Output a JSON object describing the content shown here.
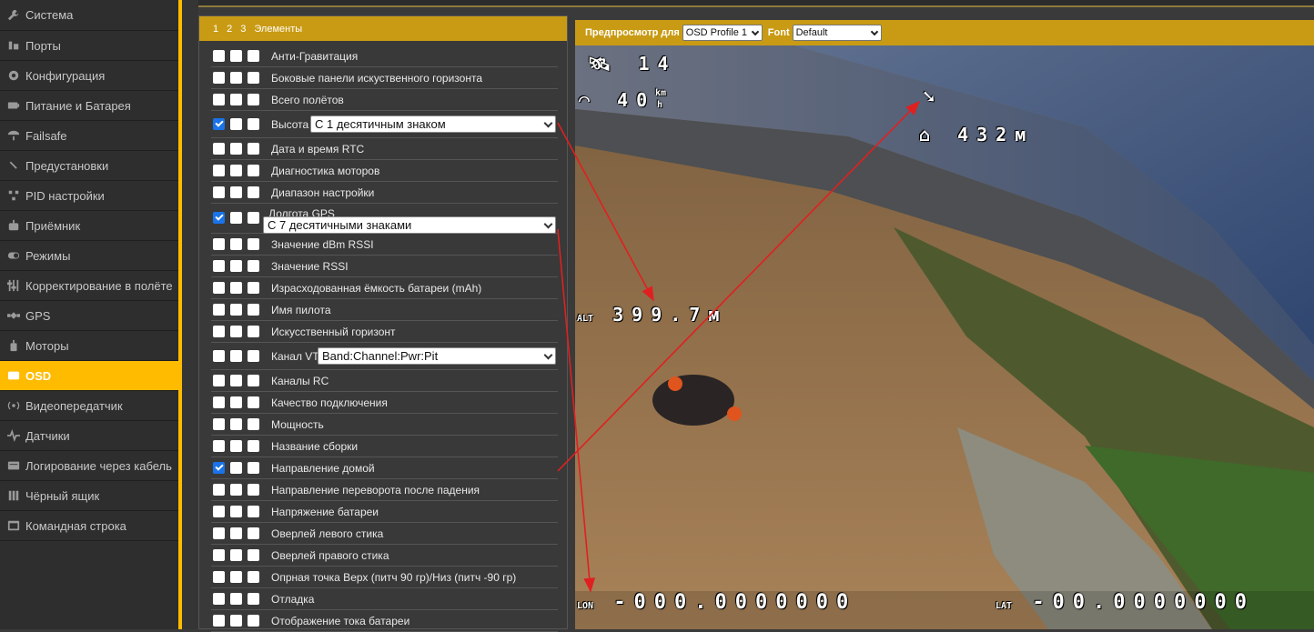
{
  "sidebar": {
    "items": [
      {
        "label": "Система",
        "icon": "wrench-icon",
        "active": false
      },
      {
        "label": "Порты",
        "icon": "plug-icon",
        "active": false
      },
      {
        "label": "Конфигурация",
        "icon": "gear-icon",
        "active": false
      },
      {
        "label": "Питание и Батарея",
        "icon": "battery-icon",
        "active": false
      },
      {
        "label": "Failsafe",
        "icon": "parachute-icon",
        "active": false
      },
      {
        "label": "Предустановки",
        "icon": "magic-wand-icon",
        "active": false
      },
      {
        "label": "PID настройки",
        "icon": "pid-icon",
        "active": false
      },
      {
        "label": "Приёмник",
        "icon": "receiver-icon",
        "active": false
      },
      {
        "label": "Режимы",
        "icon": "toggle-icon",
        "active": false
      },
      {
        "label": "Корректирование в полёте",
        "icon": "sliders-icon",
        "active": false
      },
      {
        "label": "GPS",
        "icon": "satellite-icon",
        "active": false
      },
      {
        "label": "Моторы",
        "icon": "motor-icon",
        "active": false
      },
      {
        "label": "OSD",
        "icon": "osd-icon",
        "active": true
      },
      {
        "label": "Видеопередатчик",
        "icon": "broadcast-icon",
        "active": false
      },
      {
        "label": "Датчики",
        "icon": "pulse-icon",
        "active": false
      },
      {
        "label": "Логирование через кабель",
        "icon": "cable-icon",
        "active": false
      },
      {
        "label": "Чёрный ящик",
        "icon": "blackbox-icon",
        "active": false
      },
      {
        "label": "Командная строка",
        "icon": "terminal-icon",
        "active": false
      }
    ]
  },
  "elements_panel": {
    "header": {
      "profile_1": "1",
      "profile_2": "2",
      "profile_3": "3",
      "title": "Элементы"
    },
    "rows": [
      {
        "label": "Анти-Гравитация",
        "checked": false
      },
      {
        "label": "Боковые панели искуственного горизонта",
        "checked": false
      },
      {
        "label": "Всего полётов",
        "checked": false
      },
      {
        "label": "Высота",
        "checked": true,
        "select": "С 1 десятичным знаком"
      },
      {
        "label": "Дата и время RTC",
        "checked": false
      },
      {
        "label": "Диагностика моторов",
        "checked": false
      },
      {
        "label": "Диапазон настройки",
        "checked": false
      },
      {
        "label": "Долгота GPS",
        "checked": true,
        "select": "С 7 десятичными знаками"
      },
      {
        "label": "Значение dBm RSSI",
        "checked": false
      },
      {
        "label": "Значение RSSI",
        "checked": false
      },
      {
        "label": "Израсходованная ёмкость батареи (mAh)",
        "checked": false
      },
      {
        "label": "Имя пилота",
        "checked": false
      },
      {
        "label": "Искусственный горизонт",
        "checked": false
      },
      {
        "label": "Канал VTX",
        "checked": false,
        "select": "Band:Channel:Pwr:Pit"
      },
      {
        "label": "Каналы RC",
        "checked": false
      },
      {
        "label": "Качество подключения",
        "checked": false
      },
      {
        "label": "Мощность",
        "checked": false
      },
      {
        "label": "Название сборки",
        "checked": false
      },
      {
        "label": "Направление домой",
        "checked": true
      },
      {
        "label": "Направление переворота после падения",
        "checked": false
      },
      {
        "label": "Напряжение батареи",
        "checked": false
      },
      {
        "label": "Оверлей левого стика",
        "checked": false
      },
      {
        "label": "Оверлей правого стика",
        "checked": false
      },
      {
        "label": "Опрная точка Верх (питч 90 гр)/Низ (питч -90 гр)",
        "checked": false
      },
      {
        "label": "Отладка",
        "checked": false
      },
      {
        "label": "Отображение тока батареи",
        "checked": false
      }
    ]
  },
  "preview": {
    "label": "Предпросмотр для",
    "profile_select": "OSD Profile 1",
    "font_label": "Font",
    "font_select": "Default",
    "osd": {
      "sats": "14",
      "speed": "40",
      "speed_unit_top": "km",
      "speed_unit_bottom": "h",
      "home_distance": "432м",
      "altitude_prefix": "ALT",
      "altitude": "399.7м",
      "lon_prefix": "LON",
      "lon": "-000.0000000",
      "lat_prefix": "LAT",
      "lat": "-00.0000000"
    }
  },
  "colors": {
    "accent": "#ffbb00",
    "header": "#c99b14",
    "checkbox_checked": "#1a73e8",
    "annotation_arrow": "#e02020"
  }
}
